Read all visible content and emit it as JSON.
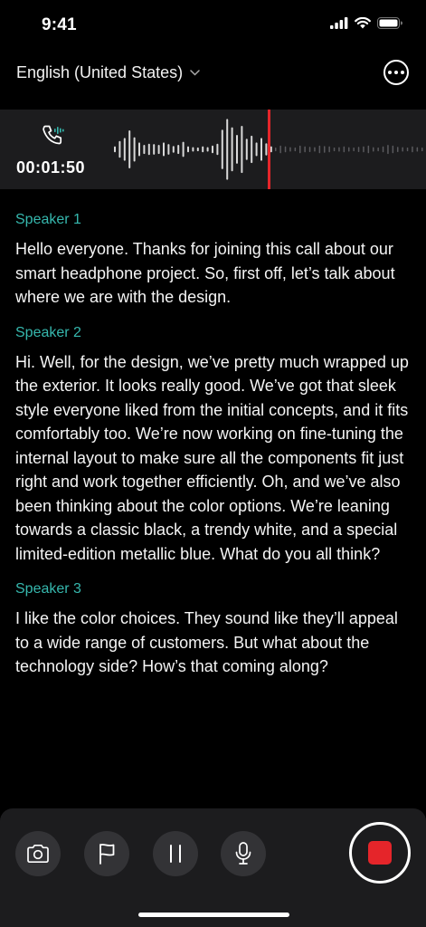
{
  "status_bar": {
    "time": "9:41"
  },
  "header": {
    "language": "English (United States)"
  },
  "recording": {
    "elapsed": "00:01:50",
    "accent_color": "#e5252a",
    "waveform_played": [
      0.08,
      0.22,
      0.3,
      0.5,
      0.32,
      0.18,
      0.12,
      0.15,
      0.14,
      0.12,
      0.18,
      0.14,
      0.09,
      0.12,
      0.2,
      0.08,
      0.06,
      0.05,
      0.08,
      0.06,
      0.1,
      0.15,
      0.52,
      0.8,
      0.58,
      0.38,
      0.62,
      0.28,
      0.36,
      0.18,
      0.3,
      0.16,
      0.08
    ],
    "waveform_upcoming": [
      0.05,
      0.1,
      0.08,
      0.06,
      0.05,
      0.1,
      0.08,
      0.07,
      0.06,
      0.1,
      0.09,
      0.08,
      0.05,
      0.06,
      0.08,
      0.06,
      0.05,
      0.07,
      0.08,
      0.1,
      0.06,
      0.05,
      0.08,
      0.12,
      0.1,
      0.07,
      0.06,
      0.05,
      0.08,
      0.06,
      0.05,
      0.04
    ]
  },
  "transcript": [
    {
      "speaker": "Speaker 1",
      "text": "Hello everyone. Thanks for joining this call about our smart headphone project. So, first off, let’s talk about where we are with the design."
    },
    {
      "speaker": "Speaker 2",
      "text": "Hi. Well, for the design, we’ve pretty much wrapped up the exterior. It looks really good. We’ve got that sleek style everyone liked from the initial concepts, and it fits comfortably too. We’re now working on fine-tuning the internal layout to make sure all the components fit just right and work together efficiently. Oh, and we’ve also been thinking about the color options. We’re leaning towards a classic black, a trendy white, and a special limited-edition metallic blue. What do you all think?"
    },
    {
      "speaker": "Speaker 3",
      "text": "I like the color choices. They sound like they’ll appeal to a wide range of customers. But what about the technology side? How’s that coming along?"
    }
  ],
  "controls": {
    "camera_icon": "camera-icon",
    "flag_icon": "flag-icon",
    "pause_icon": "pause-icon",
    "mic_icon": "microphone-icon",
    "record_icon": "stop-icon"
  }
}
